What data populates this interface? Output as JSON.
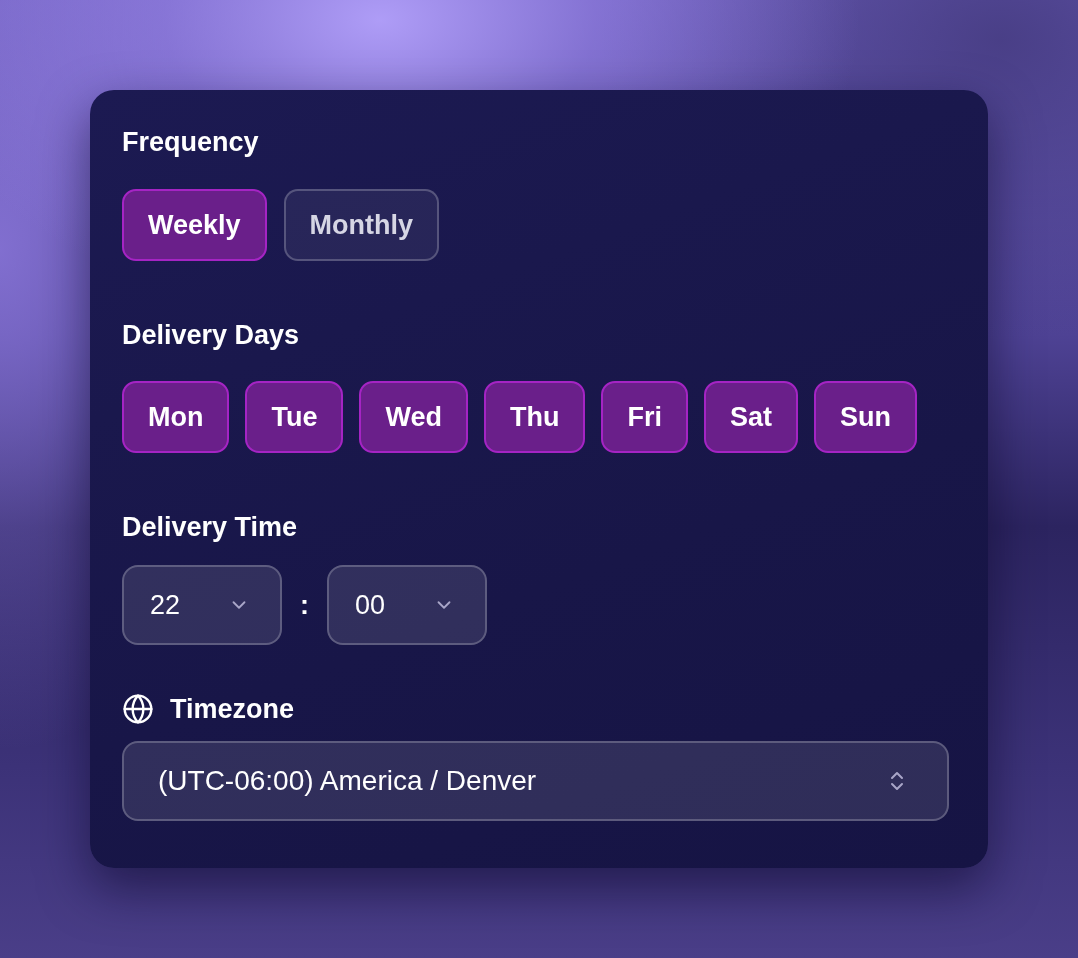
{
  "frequency": {
    "label": "Frequency",
    "options": [
      {
        "label": "Weekly",
        "selected": true
      },
      {
        "label": "Monthly",
        "selected": false
      }
    ]
  },
  "delivery_days": {
    "label": "Delivery Days",
    "days": [
      {
        "label": "Mon",
        "selected": true
      },
      {
        "label": "Tue",
        "selected": true
      },
      {
        "label": "Wed",
        "selected": true
      },
      {
        "label": "Thu",
        "selected": true
      },
      {
        "label": "Fri",
        "selected": true
      },
      {
        "label": "Sat",
        "selected": true
      },
      {
        "label": "Sun",
        "selected": true
      }
    ]
  },
  "delivery_time": {
    "label": "Delivery Time",
    "hour": "22",
    "separator": ":",
    "minute": "00"
  },
  "timezone": {
    "label": "Timezone",
    "value": "(UTC-06:00) America / Denver"
  }
}
